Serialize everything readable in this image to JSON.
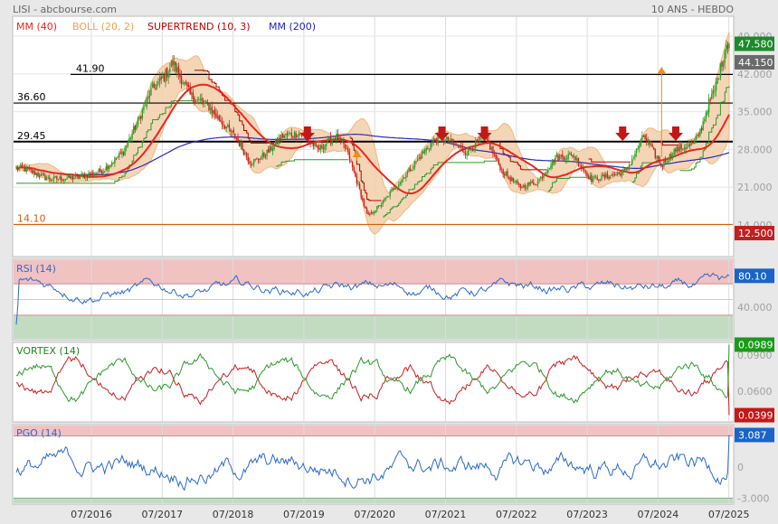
{
  "header": {
    "source": "LISI - abcbourse.com",
    "period": "10 ANS - HEBDO"
  },
  "legend": [
    {
      "label": "MM (40)",
      "color": "#e8281e"
    },
    {
      "label": "BOLL (20, 2)",
      "color": "#f0a050"
    },
    {
      "label": "SUPERTREND (10, 3)",
      "color": "#c00000"
    },
    {
      "label": "MM (200)",
      "color": "#2020c0"
    }
  ],
  "colors": {
    "up_candle": "#2aa02a",
    "down_candle": "#d02020",
    "mm40": "#e8281e",
    "mm200": "#2a2ab8",
    "boll": "#f0b070",
    "boll_fill": "#f3d2b0",
    "st_red": "#b80000",
    "st_green": "#2a9a2a",
    "rsi": "#2a6acc",
    "pgo": "#2a6acc",
    "vortex_plus": "#2a9a2a",
    "vortex_minus": "#c82020",
    "price_badge_last": "#1b8a2a",
    "price_badge_high": "#6a6a6a",
    "price_badge_low": "#c02020",
    "zone_red": "#f0c2c2",
    "zone_green": "#c2dcc2"
  },
  "chart_data": [
    {
      "type": "candlestick",
      "title": "",
      "x_ticks": [
        "07/2016",
        "07/2017",
        "07/2018",
        "07/2019",
        "07/2020",
        "07/2021",
        "07/2022",
        "07/2023",
        "07/2024",
        "07/2025"
      ],
      "ylim": [
        12.5,
        49.0
      ],
      "y_ticks": [
        "49.000",
        "42.000",
        "35.000",
        "28.000",
        "21.000",
        "14.000"
      ],
      "levels": [
        {
          "label": "41.90",
          "value": 41.9,
          "color": "#000000"
        },
        {
          "label": "36.60",
          "value": 36.6,
          "color": "#000000"
        },
        {
          "label": "29.45",
          "value": 29.45,
          "color": "#000000"
        },
        {
          "label": "14.10",
          "value": 14.1,
          "color": "#d06010"
        }
      ],
      "price_badges": [
        {
          "label": "47.580",
          "value": 47.58,
          "kind": "last"
        },
        {
          "label": "44.150",
          "value": 44.15,
          "kind": "high"
        },
        {
          "label": "12.500",
          "value": 12.5,
          "kind": "low"
        }
      ],
      "sell_signals_dates": [
        2019.55,
        2021.45,
        2022.05,
        2024.0,
        2024.75
      ],
      "buy_signals_dates": [
        2020.25,
        2024.55
      ],
      "anchor_series": {
        "dates": [
          2015.55,
          2015.9,
          2016.3,
          2016.65,
          2016.95,
          2017.15,
          2017.35,
          2017.5,
          2017.65,
          2017.9,
          2018.15,
          2018.35,
          2018.55,
          2018.75,
          2018.95,
          2019.2,
          2019.45,
          2019.7,
          2019.95,
          2020.1,
          2020.25,
          2020.4,
          2020.6,
          2020.85,
          2021.1,
          2021.35,
          2021.55,
          2021.8,
          2022.05,
          2022.3,
          2022.55,
          2022.8,
          2023.05,
          2023.3,
          2023.55,
          2023.8,
          2024.05,
          2024.3,
          2024.55,
          2024.75,
          2024.9,
          2025.0,
          2025.1,
          2025.2,
          2025.3,
          2025.4,
          2025.46
        ],
        "closes": [
          24.5,
          22.5,
          22.8,
          24.0,
          27.5,
          33.0,
          39.0,
          41.0,
          44.0,
          38.0,
          36.0,
          33.0,
          30.0,
          25.5,
          27.0,
          30.5,
          31.0,
          28.0,
          30.5,
          28.0,
          22.0,
          15.5,
          18.0,
          22.0,
          26.0,
          30.0,
          29.5,
          27.5,
          30.5,
          24.0,
          21.0,
          22.0,
          26.5,
          27.0,
          22.5,
          23.0,
          24.0,
          30.5,
          25.0,
          28.0,
          28.5,
          29.0,
          31.5,
          36.0,
          39.0,
          44.0,
          47.58
        ]
      }
    },
    {
      "type": "line",
      "title": "RSI (14)",
      "ylim": [
        0,
        100
      ],
      "y_ticks": [
        "80.000",
        "40.000"
      ],
      "reference_values": [
        30,
        50,
        70
      ],
      "last_label": "80.10",
      "last_value": 80.1
    },
    {
      "type": "line",
      "title": "VORTEX (14)",
      "ylim": [
        0.035,
        0.1
      ],
      "y_ticks": [
        "0.0900",
        "0.0600"
      ],
      "series": [
        {
          "name": "VI+",
          "last_label": "0.0989",
          "last_value": 0.0989
        },
        {
          "name": "VI-",
          "last_label": "0.0399",
          "last_value": 0.0399
        }
      ]
    },
    {
      "type": "line",
      "title": "PGO (14)",
      "ylim": [
        -3.5,
        4.0
      ],
      "y_ticks": [
        "3.000",
        "0",
        "-3.000"
      ],
      "reference_values": [
        3.0,
        -3.0
      ],
      "last_label": "3.087",
      "last_value": 3.087
    }
  ]
}
